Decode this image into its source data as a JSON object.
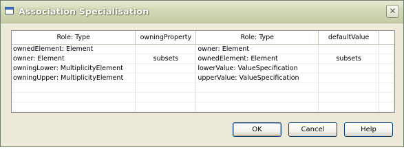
{
  "window": {
    "title": "Association Specialisation",
    "close_glyph": "✕"
  },
  "table": {
    "headers": [
      "Role: Type",
      "owningProperty",
      "Role: Type",
      "defaultValue"
    ],
    "rows": [
      [
        "ownedElement: Element",
        "",
        "owner: Element",
        ""
      ],
      [
        "owner: Element",
        "subsets",
        "ownedElement: Element",
        "subsets"
      ],
      [
        "owningLower: MultiplicityElement",
        "",
        "lowerValue: ValueSpecification",
        ""
      ],
      [
        "owningUpper: MultiplicityElement",
        "",
        "upperValue: ValueSpecification",
        ""
      ],
      [
        "",
        "",
        "",
        ""
      ],
      [
        "",
        "",
        "",
        ""
      ],
      [
        "",
        "",
        "",
        ""
      ]
    ]
  },
  "buttons": {
    "ok": "OK",
    "cancel": "Cancel",
    "help": "Help"
  }
}
